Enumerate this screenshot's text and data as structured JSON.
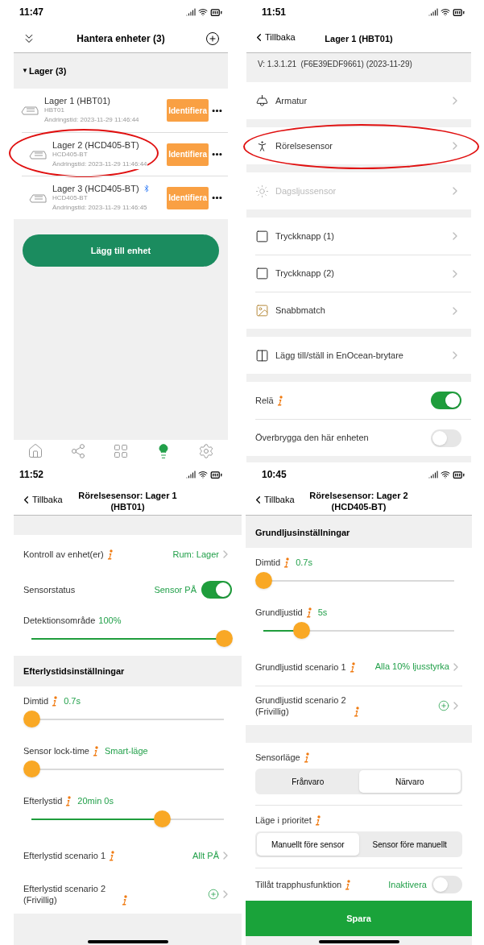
{
  "device_list_screen": {
    "status_time": "11:47",
    "title": "Hantera enheter (3)",
    "group": {
      "caret": "▼",
      "title": "Lager (3)",
      "expanded": true
    },
    "devices": [
      {
        "name": "Lager 1 (HBT01)",
        "model": "HBT01",
        "changed": "Ändringstid: 2023-11-29 11:46:44",
        "button": "Identifiera",
        "bluetooth": false,
        "circled": false
      },
      {
        "name": "Lager 2 (HCD405-BT)",
        "model": "HCD405-BT",
        "changed": "Ändringstid: 2023-11-29 11:46:44",
        "button": "Identifiera",
        "bluetooth": false,
        "circled": true
      },
      {
        "name": "Lager 3 (HCD405-BT)",
        "model": "HCD405-BT",
        "changed": "Ändringstid: 2023-11-29 11:46:45",
        "button": "Identifiera",
        "bluetooth": true,
        "circled": false
      }
    ],
    "add_button": "Lägg till enhet",
    "tabs": [
      {
        "selected": false
      },
      {
        "selected": false
      },
      {
        "selected": false
      },
      {
        "selected": true
      },
      {
        "selected": false
      }
    ]
  },
  "device_screen": {
    "status_time": "11:51",
    "back": "Tillbaka",
    "title": "Lager 1 (HBT01)",
    "version": "V: 1.3.1.21  (F6E39EDF9661) (2023-11-29)",
    "groups": [
      {
        "items": [
          {
            "label": "Armatur",
            "disabled": false,
            "circled": false
          }
        ]
      },
      {
        "items": [
          {
            "label": "Rörelsesensor",
            "disabled": false,
            "circled": true
          }
        ]
      },
      {
        "items": [
          {
            "label": "Dagsljussensor",
            "disabled": true,
            "circled": false
          }
        ]
      },
      {
        "items": [
          {
            "label": "Tryckknapp (1)",
            "disabled": false,
            "circled": false
          },
          {
            "label": "Tryckknapp (2)",
            "disabled": false,
            "circled": false
          },
          {
            "label": "Snabbmatch",
            "disabled": false,
            "circled": false
          }
        ]
      },
      {
        "items": [
          {
            "label": "Lägg till/ställ in EnOcean-brytare",
            "disabled": false,
            "circled": false
          }
        ]
      }
    ],
    "toggles": [
      {
        "label": "Relä",
        "info": true,
        "on": true
      },
      {
        "label": "Överbrygga den här enheten",
        "info": false,
        "on": false
      }
    ]
  },
  "sensor_screen_1": {
    "status_time": "11:52",
    "back": "Tillbaka",
    "title": "Rörelsesensor: Lager 1 (HBT01)",
    "rows": [
      {
        "kind": "section"
      },
      {
        "kind": "link",
        "label": "Kontroll av enhet(er)",
        "info": true,
        "value": "Rum: Lager"
      },
      {
        "kind": "toggle",
        "label": "Sensorstatus",
        "info": false,
        "value": "Sensor PÅ",
        "on": true
      },
      {
        "kind": "slider",
        "label": "Detektionsområde",
        "info": false,
        "value": "100%",
        "level": 1
      },
      {
        "kind": "section",
        "title": "Efterlystidsinställningar"
      },
      {
        "kind": "slider",
        "label": "Dimtid",
        "info": true,
        "value": "0.7s",
        "level": 0
      },
      {
        "kind": "slider",
        "label": "Sensor lock-time",
        "info": true,
        "value": "Smart-läge",
        "level": 0
      },
      {
        "kind": "slider",
        "label": "Efterlystid",
        "info": true,
        "value": "20min 0s",
        "level": 0.68
      },
      {
        "kind": "link",
        "label": "Efterlystid scenario 1",
        "info": true,
        "value": "Allt PÅ"
      },
      {
        "kind": "link",
        "label": "Efterlystid scenario 2 (Frivillig)",
        "info": true,
        "add": true
      }
    ]
  },
  "sensor_screen_2": {
    "status_time": "10:45",
    "back": "Tillbaka",
    "title": "Rörelsesensor: Lager 2 (HCD405-BT)",
    "rows": [
      {
        "kind": "section",
        "title": "Grundljusinställningar"
      },
      {
        "kind": "slider",
        "label": "Dimtid",
        "info": true,
        "value": "0.7s",
        "level": 0
      },
      {
        "kind": "slider",
        "label": "Grundljustid",
        "info": true,
        "value": "5s",
        "level": 0.2
      },
      {
        "kind": "link",
        "label": "Grundljustid scenario 1",
        "info": true,
        "value": "Alla 10% ljusstyrka",
        "divider": true
      },
      {
        "kind": "link",
        "label": "Grundljustid scenario 2 (Frivillig)",
        "info": true,
        "add": true
      },
      {
        "kind": "section"
      },
      {
        "kind": "segmented",
        "label": "Sensorläge",
        "info": true,
        "options": [
          {
            "label": "Frånvaro",
            "selected": false
          },
          {
            "label": "Närvaro",
            "selected": true
          }
        ]
      },
      {
        "kind": "segmented",
        "label": "Läge i prioritet",
        "info": true,
        "options": [
          {
            "label": "Manuellt före sensor",
            "selected": true
          },
          {
            "label": "Sensor före manuellt",
            "selected": false
          }
        ]
      },
      {
        "kind": "toggle",
        "label": "Tillåt trapphusfunktion",
        "info": true,
        "value": "Inaktivera",
        "on": false
      },
      {
        "kind": "button",
        "label": "Spara"
      }
    ]
  }
}
